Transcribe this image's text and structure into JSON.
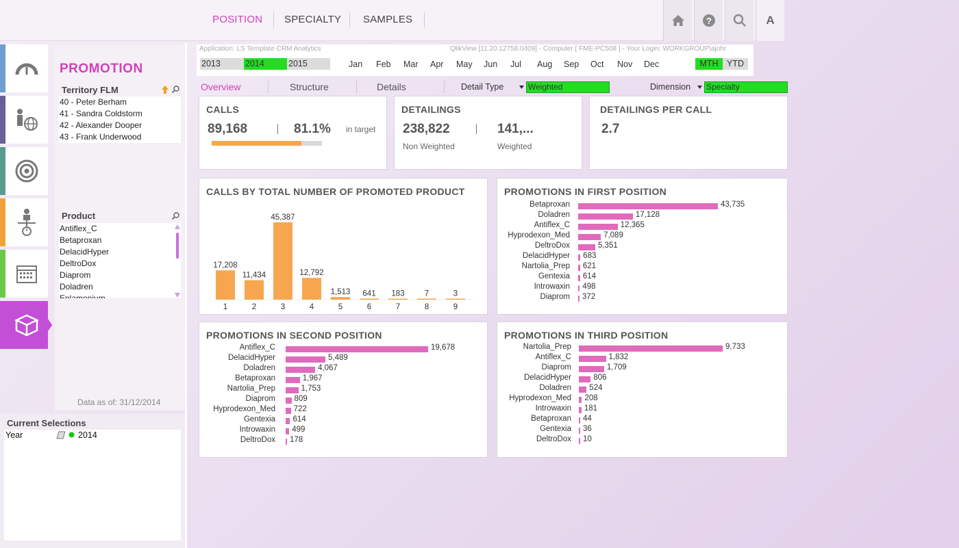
{
  "nav": {
    "tabs": [
      {
        "label": "POSITION"
      },
      {
        "label": "SPECIALTY"
      },
      {
        "label": "SAMPLES"
      }
    ],
    "icons": [
      "home-icon",
      "help-icon",
      "search-icon"
    ],
    "a_label": "A",
    "active_color": "#d43fbd"
  },
  "sidebar": {
    "items": [
      {
        "icon": "gauge-icon",
        "color": "#6f9ed1"
      },
      {
        "icon": "presenter-globe-icon",
        "color": "#6b5f9a"
      },
      {
        "icon": "target-icon",
        "color": "#5a9a8f"
      },
      {
        "icon": "org-chart-icon",
        "color": "#f2a23a"
      },
      {
        "icon": "calendar-icon",
        "color": "#6ec84b"
      },
      {
        "icon": "box-icon",
        "color": "#c34fd6"
      }
    ]
  },
  "left": {
    "section_title": "PROMOTION",
    "territory_label": "Territory FLM",
    "territory_items": [
      "40 - Peter Berham",
      "41 - Sandra Coldstorm",
      "42 - Alexander Dooper",
      "43 - Frank Underwood"
    ],
    "product_label": "Product",
    "product_items": [
      "Antiflex_C",
      "Betaproxan",
      "DelacidHyper",
      "DeltroDox",
      "Diaprom",
      "Doladren",
      "Eplamonium"
    ],
    "data_as_of": "Data as of: 31/12/2014"
  },
  "current_selections": {
    "title": "Current Selections",
    "field": "Year",
    "value": "2014"
  },
  "header": {
    "application": "Application: LS Template CRM Analytics",
    "info": "QlikView [11.20.12758.0409]  -  Computer [ FME-PC508 ] - Your Login: WORKGROUP\\ajohr",
    "years": [
      {
        "label": "2013",
        "selected": false
      },
      {
        "label": "2014",
        "selected": true
      },
      {
        "label": "2015",
        "selected": false
      }
    ],
    "months": [
      "Jan",
      "Feb",
      "Mar",
      "Apr",
      "May",
      "Jun",
      "Jul",
      "Aug",
      "Sep",
      "Oct",
      "Nov",
      "Dec"
    ],
    "mth_label": "MTH",
    "ytd_label": "YTD",
    "select_color": "#22dd22"
  },
  "subnav": {
    "tabs": [
      "Overview",
      "Structure",
      "Details"
    ],
    "detail_type_label": "Detail Type",
    "detail_type_value": "Weighted",
    "dimension_label": "Dimension",
    "dimension_value": "Specialty"
  },
  "kpis": {
    "calls": {
      "title": "CALLS",
      "value": "89,168",
      "percent": "81.1%",
      "target_label": "in target",
      "progress": 0.811
    },
    "detailings": {
      "title": "DETAILINGS",
      "non_weighted": "238,822",
      "non_weighted_label": "Non Weighted",
      "weighted": "141,...",
      "weighted_label": "Weighted"
    },
    "dpc": {
      "title": "DETAILINGS PER CALL",
      "value": "2.7"
    }
  },
  "chart_data": [
    {
      "type": "bar",
      "title": "CALLS BY TOTAL NUMBER OF PROMOTED PRODUCT",
      "categories": [
        "1",
        "2",
        "3",
        "4",
        "5",
        "6",
        "7",
        "8",
        "9"
      ],
      "values": [
        17208,
        11434,
        45387,
        12792,
        1513,
        641,
        183,
        7,
        3
      ],
      "value_labels": [
        "17,208",
        "11,434",
        "45,387",
        "12,792",
        "1,513",
        "641",
        "183",
        "7",
        "3"
      ],
      "color": "#f7a64f",
      "ylim": [
        0,
        45387
      ]
    },
    {
      "type": "bar",
      "orientation": "horizontal",
      "title": "PROMOTIONS IN FIRST POSITION",
      "categories": [
        "Betaproxan",
        "Doladren",
        "Antiflex_C",
        "Hyprodexon_Med",
        "DeltroDox",
        "DelacidHyper",
        "Nartolia_Prep",
        "Gentexia",
        "Introwaxin",
        "Diaprom"
      ],
      "values": [
        43735,
        17128,
        12365,
        7089,
        5351,
        683,
        621,
        614,
        498,
        372
      ],
      "value_labels": [
        "43,735",
        "17,128",
        "12,365",
        "7,089",
        "5,351",
        "683",
        "621",
        "614",
        "498",
        "372"
      ],
      "color": "#e06bbd"
    },
    {
      "type": "bar",
      "orientation": "horizontal",
      "title": "PROMOTIONS IN SECOND POSITION",
      "categories": [
        "Antiflex_C",
        "DelacidHyper",
        "Doladren",
        "Betaproxan",
        "Nartolia_Prep",
        "Diaprom",
        "Hyprodexon_Med",
        "Gentexia",
        "Introwaxin",
        "DeltroDox"
      ],
      "values": [
        19678,
        5489,
        4067,
        1967,
        1753,
        809,
        722,
        614,
        499,
        178
      ],
      "value_labels": [
        "19,678",
        "5,489",
        "4,067",
        "1,967",
        "1,753",
        "809",
        "722",
        "614",
        "499",
        "178"
      ],
      "color": "#e06bbd"
    },
    {
      "type": "bar",
      "orientation": "horizontal",
      "title": "PROMOTIONS IN THIRD POSITION",
      "categories": [
        "Nartolia_Prep",
        "Antiflex_C",
        "Diaprom",
        "DelacidHyper",
        "Doladren",
        "Hyprodexon_Med",
        "Introwaxin",
        "Betaproxan",
        "Gentexia",
        "DeltroDox"
      ],
      "values": [
        9733,
        1832,
        1709,
        806,
        524,
        208,
        181,
        44,
        36,
        10
      ],
      "value_labels": [
        "9,733",
        "1,832",
        "1,709",
        "806",
        "524",
        "208",
        "181",
        "44",
        "36",
        "10"
      ],
      "color": "#e06bbd"
    }
  ]
}
